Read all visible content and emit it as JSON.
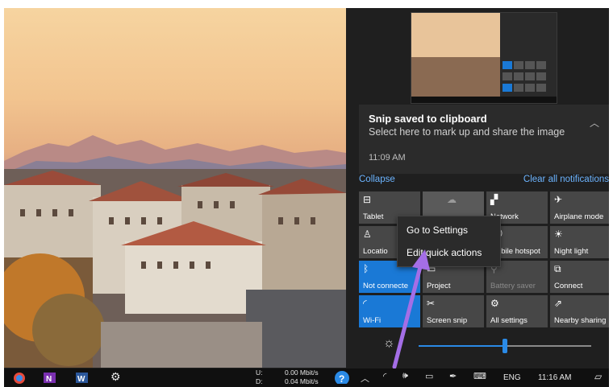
{
  "notification": {
    "title": "Snip saved to clipboard",
    "body": "Select here to mark up and share the image",
    "time": "11:09 AM"
  },
  "actions": {
    "collapse": "Collapse",
    "clear_all": "Clear all notifications"
  },
  "tiles": [
    {
      "label": "Tablet",
      "icon": "tablet-icon",
      "glyph": "⊟"
    },
    {
      "label": "",
      "icon": "wifi-cloud-icon",
      "glyph": "☁"
    },
    {
      "label": "Network",
      "icon": "network-icon",
      "glyph": "▞"
    },
    {
      "label": "Airplane mode",
      "icon": "airplane-icon",
      "glyph": "✈"
    },
    {
      "label": "Locatio",
      "icon": "location-icon",
      "glyph": "♙"
    },
    {
      "label": "",
      "icon": "blank-icon",
      "glyph": ""
    },
    {
      "label": "Mobile hotspot",
      "icon": "hotspot-icon",
      "glyph": "((·))"
    },
    {
      "label": "Night light",
      "icon": "night-light-icon",
      "glyph": "☀"
    },
    {
      "label": "Not connecte",
      "icon": "bluetooth-icon",
      "glyph": "ᛒ"
    },
    {
      "label": "Project",
      "icon": "project-icon",
      "glyph": "▭"
    },
    {
      "label": "Battery saver",
      "icon": "battery-saver-icon",
      "glyph": "⚲"
    },
    {
      "label": "Connect",
      "icon": "connect-icon",
      "glyph": "⧉"
    },
    {
      "label": "Wi-Fi",
      "icon": "wifi-icon",
      "glyph": "◜"
    },
    {
      "label": "Screen snip",
      "icon": "screen-snip-icon",
      "glyph": "✂"
    },
    {
      "label": "All settings",
      "icon": "settings-icon",
      "glyph": "⚙"
    },
    {
      "label": "Nearby sharing",
      "icon": "nearby-sharing-icon",
      "glyph": "⇗"
    }
  ],
  "context_menu": {
    "items": [
      "Go to Settings",
      "Edit quick actions"
    ]
  },
  "brightness": {
    "level": 0.5
  },
  "taskbar": {
    "net_up_label": "U:",
    "net_up": "0.00 Mbit/s",
    "net_down_label": "D:",
    "net_down": "0.04 Mbit/s",
    "language": "ENG",
    "time": "11:16 AM"
  }
}
